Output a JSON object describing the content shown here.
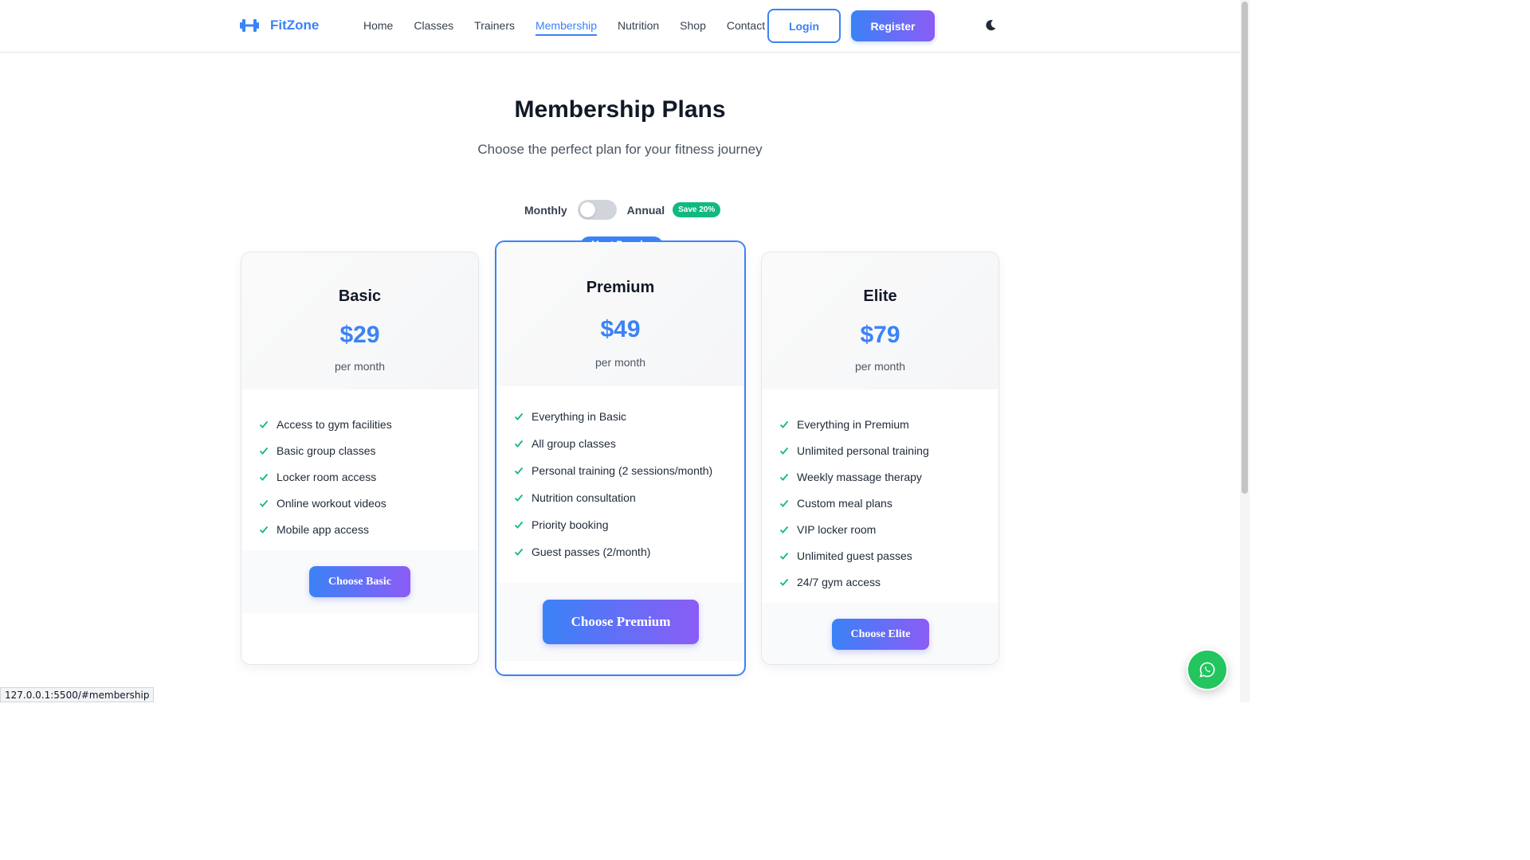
{
  "header": {
    "brand": "FitZone",
    "nav": [
      "Home",
      "Classes",
      "Trainers",
      "Membership",
      "Nutrition",
      "Shop",
      "Contact"
    ],
    "active_nav": "Membership",
    "login_label": "Login",
    "register_label": "Register"
  },
  "section": {
    "title": "Membership Plans",
    "subtitle": "Choose the perfect plan for your fitness journey"
  },
  "billing": {
    "monthly_label": "Monthly",
    "annual_label": "Annual",
    "save_badge": "Save 20%",
    "annual_enabled": false
  },
  "plans": [
    {
      "name": "Basic",
      "price": "$29",
      "period": "per month",
      "features": [
        "Access to gym facilities",
        "Basic group classes",
        "Locker room access",
        "Online workout videos",
        "Mobile app access"
      ],
      "button": "Choose Basic"
    },
    {
      "name": "Premium",
      "badge": "Most Popular",
      "price": "$49",
      "period": "per month",
      "features": [
        "Everything in Basic",
        "All group classes",
        "Personal training (2 sessions/month)",
        "Nutrition consultation",
        "Priority booking",
        "Guest passes (2/month)"
      ],
      "button": "Choose Premium"
    },
    {
      "name": "Elite",
      "price": "$79",
      "period": "per month",
      "features": [
        "Everything in Premium",
        "Unlimited personal training",
        "Weekly massage therapy",
        "Custom meal plans",
        "VIP locker room",
        "Unlimited guest passes",
        "24/7 gym access"
      ],
      "button": "Choose Elite"
    }
  ],
  "status_url": "127.0.0.1:5500/#membership",
  "colors": {
    "primary": "#3b82f6",
    "accent": "#8b5cf6",
    "success": "#10b981",
    "whatsapp": "#22c55e"
  },
  "icons": {
    "logo": "dumbbell-icon",
    "theme": "moon-icon",
    "feature": "check-icon",
    "chat": "whatsapp-icon"
  }
}
